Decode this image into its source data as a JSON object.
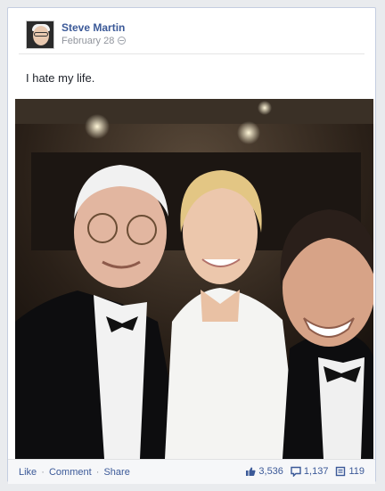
{
  "post": {
    "author": "Steve Martin",
    "date": "February 28",
    "privacy_icon": "globe-icon",
    "text": "I hate my life.",
    "photo_icon": "photo"
  },
  "footer": {
    "like_label": "Like",
    "comment_label": "Comment",
    "share_label": "Share",
    "separator": "·",
    "likes_count": "3,536",
    "comments_count": "1,137",
    "shares_count": "119"
  },
  "colors": {
    "link": "#3b5998",
    "meta": "#90949c",
    "text": "#1d2129"
  }
}
